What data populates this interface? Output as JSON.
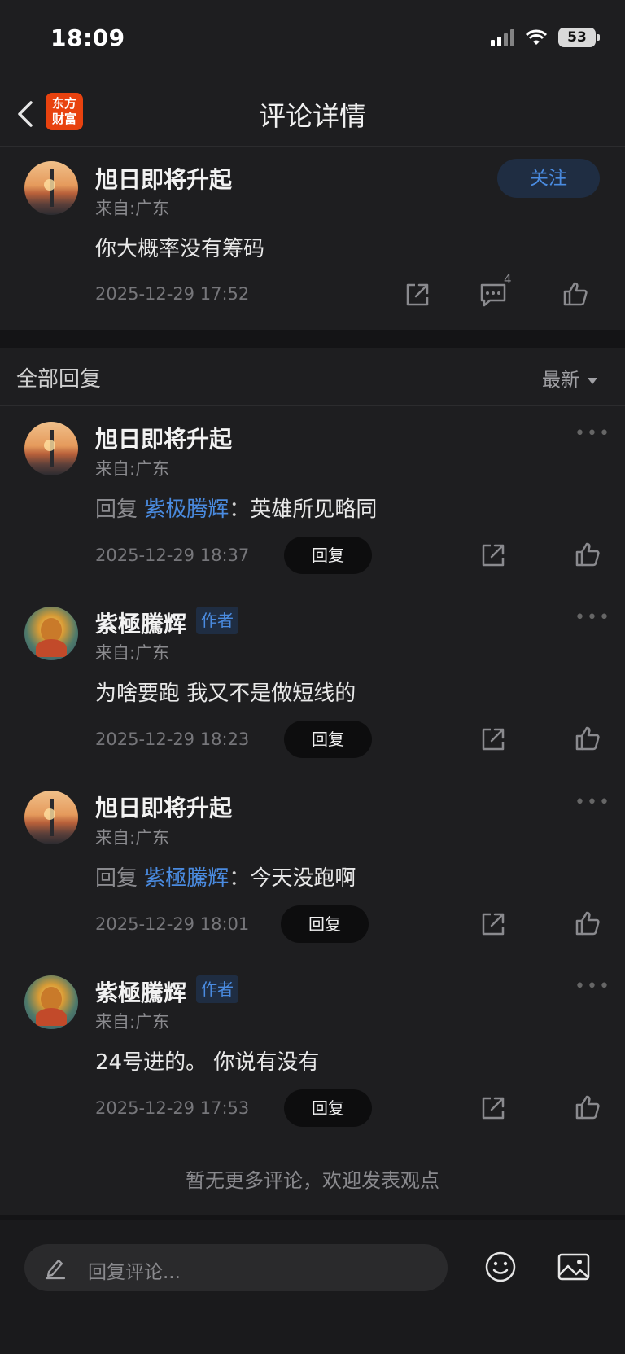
{
  "status_bar": {
    "time": "18:09",
    "battery": "53"
  },
  "nav": {
    "title": "评论详情",
    "logo_line1": "东方",
    "logo_line2": "财富"
  },
  "main_comment": {
    "username": "旭日即将升起",
    "source": "来自:广东",
    "text": "你大概率没有筹码",
    "time": "2025-12-29 17:52",
    "comment_count": "4",
    "follow_label": "关注"
  },
  "section": {
    "title": "全部回复",
    "sort_label": "最新"
  },
  "replies": [
    {
      "username": "旭日即将升起",
      "source": "来自:广东",
      "is_author": false,
      "reply_prefix": "回复",
      "mention": "紫极腾辉",
      "colon": "：",
      "text": "英雄所见略同",
      "time": "2025-12-29 18:37",
      "reply_label": "回复"
    },
    {
      "username": "紫極騰辉",
      "author_tag": "作者",
      "source": "来自:广东",
      "is_author": true,
      "text": "为啥要跑 我又不是做短线的",
      "time": "2025-12-29 18:23",
      "reply_label": "回复"
    },
    {
      "username": "旭日即将升起",
      "source": "来自:广东",
      "is_author": false,
      "reply_prefix": "回复",
      "mention": "紫極騰辉",
      "colon": "：",
      "text": "今天没跑啊",
      "time": "2025-12-29 18:01",
      "reply_label": "回复"
    },
    {
      "username": "紫極騰辉",
      "author_tag": "作者",
      "source": "来自:广东",
      "is_author": true,
      "text": "24号进的。 你说有没有",
      "time": "2025-12-29 17:53",
      "reply_label": "回复"
    }
  ],
  "footer": {
    "no_more": "暂无更多评论，欢迎发表观点"
  },
  "input": {
    "placeholder": "回复评论..."
  },
  "colors": {
    "background": "#1e1e20",
    "accent_blue": "#4a8be0",
    "brand_orange": "#e8420f"
  }
}
